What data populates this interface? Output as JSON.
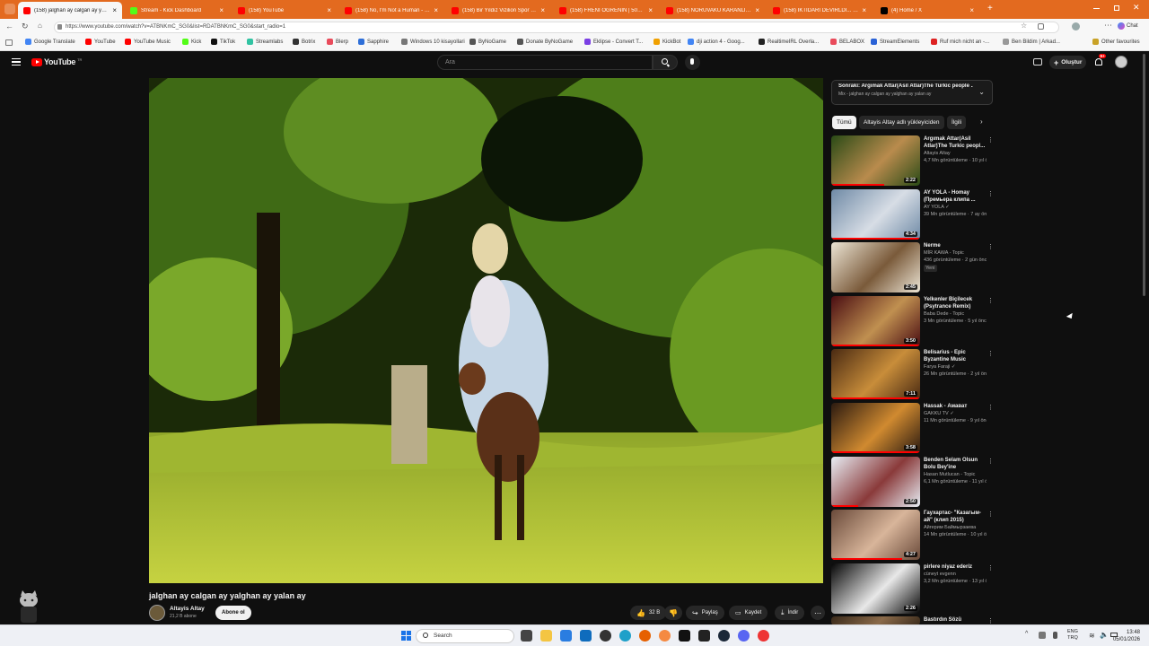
{
  "browser": {
    "tabs": [
      {
        "label": "(158) jalghan ay calgan ay yal...",
        "color": "#ff0000",
        "active": true
      },
      {
        "label": "Stream - Kick Dashboard",
        "color": "#53fc18",
        "active": false
      },
      {
        "label": "(158) YouTube",
        "color": "#ff0000",
        "active": false
      },
      {
        "label": "(158) No, I'm Not a Human - Offic",
        "color": "#ff0000",
        "active": false
      },
      {
        "label": "(158) Bir Yıldız Vizilion Spor Salonu",
        "color": "#ff0000",
        "active": false
      },
      {
        "label": "(158) FRENİ ÖĞRENİN | 50sders | ...",
        "color": "#ff0000",
        "active": false
      },
      {
        "label": "(158) NORUVAKU KARANLIK YÜZ",
        "color": "#ff0000",
        "active": false
      },
      {
        "label": "(158) İKTİDARI DEVİRLDİ... - YouTub",
        "color": "#ff0000",
        "active": false
      },
      {
        "label": "(4) Home / X",
        "color": "#000000",
        "active": false
      }
    ],
    "new_tab": "+",
    "url": "https://www.youtube.com/watch?v=ATBNKmC_SG0&list=RDATBNKmC_SG0&start_radio=1",
    "bookmarks": [
      {
        "label": "Google Translate",
        "color": "#4285f4"
      },
      {
        "label": "YouTube",
        "color": "#ff0000"
      },
      {
        "label": "YouTube Music",
        "color": "#ff0000"
      },
      {
        "label": "Kick",
        "color": "#53fc18"
      },
      {
        "label": "TikTok",
        "color": "#111111"
      },
      {
        "label": "Streamlabs",
        "color": "#31c3a2"
      },
      {
        "label": "Botrix",
        "color": "#333333"
      },
      {
        "label": "Blerp",
        "color": "#e94b5b"
      },
      {
        "label": "Sapphire",
        "color": "#2e6fd8"
      },
      {
        "label": "Windows 10 kisayollari",
        "color": "#777777"
      },
      {
        "label": "ByNoGame",
        "color": "#555555"
      },
      {
        "label": "Donate ByNoGame",
        "color": "#555555"
      },
      {
        "label": "Eklipse - Convert T...",
        "color": "#7b3fe4"
      },
      {
        "label": "KickBot",
        "color": "#f0a000"
      },
      {
        "label": "dji action 4 - Goog...",
        "color": "#4285f4"
      },
      {
        "label": "RealtimeIRL Overla...",
        "color": "#222222"
      },
      {
        "label": "BELABOX",
        "color": "#e94b5b"
      },
      {
        "label": "StreamElements",
        "color": "#2a62d6"
      },
      {
        "label": "Ruf mich nicht an -...",
        "color": "#d22"
      },
      {
        "label": "Ben Bildim | Arkad...",
        "color": "#999999"
      }
    ],
    "other_favourites": "Other favourites",
    "chat_label": "Chat"
  },
  "youtube": {
    "logo_text": "YouTube",
    "logo_sup": "TR",
    "search_placeholder": "Ara",
    "create_label": "Oluştur",
    "notif_count": "9+",
    "video": {
      "title": "jalghan ay calgan ay yalghan ay yalan ay",
      "channel": "Altayis Altay",
      "subscribers": "21,2 B abone",
      "subscribe_label": "Abone ol",
      "likes": "32 B",
      "share_label": "Paylaş",
      "save_label": "Kaydet",
      "download_label": "İndir"
    },
    "next_up": {
      "title": "Sonraki: Argımak Attar(Asil Atlar)The Turkic people ...",
      "subtitle": "Mix - jalghan ay calgan ay yalghan ay yalan ay"
    },
    "chips": [
      "Tümü",
      "Altayis Altay adlı yükleyiciden",
      "İlgili"
    ],
    "recommendations": [
      {
        "title": "Argımak Attar(Asil Atlar)The Turkic peopl...",
        "channel": "Altayis Altay",
        "views": "4,7 Mn görüntüleme · 10 yıl ön...",
        "duration": "2:22",
        "progress": 0.6,
        "thumb": [
          "#2a4a16",
          "#b98b4d"
        ]
      },
      {
        "title": "AY YOLA - Homay (Премьера клипа ...",
        "channel": "AY YOLA ✓",
        "views": "39 Mn görüntüleme · 7 ay önce",
        "duration": "4:34",
        "progress": 1.0,
        "thumb": [
          "#6f8aa6",
          "#d7dde5"
        ]
      },
      {
        "title": "Nerme",
        "channel": "MİR KAWA - Topic",
        "views": "436 görüntüleme · 2 gün önce",
        "duration": "2:45",
        "progress": 0,
        "badge": "Yeni",
        "thumb": [
          "#ece5d5",
          "#7a5a3a"
        ]
      },
      {
        "title": "Yelkenler Biçilecek (Psytrance Remix)",
        "channel": "Baba Dede - Topic",
        "views": "3 Mn görüntüleme · 5 yıl önce",
        "duration": "3:50",
        "progress": 1.0,
        "thumb": [
          "#4a0d12",
          "#c09050"
        ]
      },
      {
        "title": "Belisarius - Epic Byzantine Music",
        "channel": "Farya Faraji ✓",
        "views": "26 Mn görüntüleme · 2 yıl önce",
        "duration": "7:11",
        "progress": 1.0,
        "thumb": [
          "#4a2a12",
          "#c88d3a"
        ]
      },
      {
        "title": "Hassak - Амават",
        "channel": "GAKKU TV ✓",
        "views": "11 Mn görüntüleme · 9 yıl önce",
        "duration": "3:58",
        "progress": 1.0,
        "thumb": [
          "#2b1a10",
          "#d08a30"
        ]
      },
      {
        "title": "Benden Selam Olsun Bolu Bey'ine",
        "channel": "Hasan Mutlucan - Topic",
        "views": "6,1 Mn görüntüleme · 11 yıl ön...",
        "duration": "2:50",
        "progress": 0.3,
        "thumb": [
          "#e8eef5",
          "#8a3a3a"
        ]
      },
      {
        "title": "Гаухартас- \"Казагым-ай\" (клип 2015)",
        "channel": "Айгерим Баймырзаева",
        "views": "14 Mn görüntüleme · 10 yıl önce",
        "duration": "4:27",
        "progress": 0.8,
        "thumb": [
          "#6a4a3a",
          "#d8b59a"
        ]
      },
      {
        "title": "pirlere niyaz ederiz",
        "channel": "cüneyt evgenn",
        "views": "3,2 Mn görüntüleme · 13 yıl ön...",
        "duration": "2:26",
        "progress": 0,
        "thumb": [
          "#050505",
          "#e8e8e8"
        ]
      },
      {
        "title": "Bastırdın Sözü",
        "channel": "",
        "views": "",
        "duration": "",
        "progress": 0,
        "thumb": [
          "#3a2a1a",
          "#8a6a4a"
        ]
      }
    ]
  },
  "taskbar": {
    "search_placeholder": "Search",
    "lang_top": "ENG",
    "lang_bottom": "TRQ",
    "time": "13:48",
    "date": "05/01/2026"
  }
}
